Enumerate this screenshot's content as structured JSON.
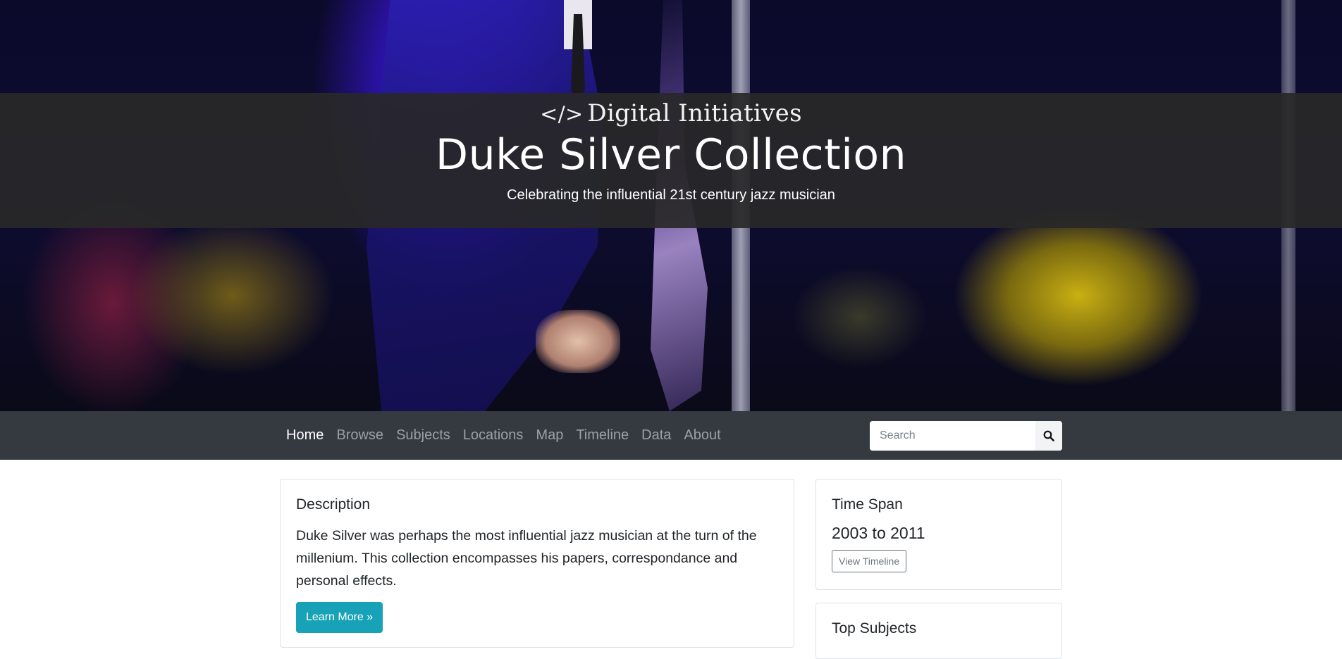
{
  "hero": {
    "brand_code": "</>",
    "brand_name": "Digital Initiatives",
    "title": "Duke Silver Collection",
    "tagline": "Celebrating the influential 21st century jazz musician"
  },
  "nav": {
    "items": [
      {
        "label": "Home",
        "active": true
      },
      {
        "label": "Browse",
        "active": false
      },
      {
        "label": "Subjects",
        "active": false
      },
      {
        "label": "Locations",
        "active": false
      },
      {
        "label": "Map",
        "active": false
      },
      {
        "label": "Timeline",
        "active": false
      },
      {
        "label": "Data",
        "active": false
      },
      {
        "label": "About",
        "active": false
      }
    ],
    "search_placeholder": "Search",
    "search_icon": "search-icon"
  },
  "description": {
    "heading": "Description",
    "text": "Duke Silver was perhaps the most influential jazz musician at the turn of the millenium. This collection encompasses his papers, correspondance and personal effects.",
    "button": "Learn More »"
  },
  "timespan": {
    "heading": "Time Span",
    "value": "2003 to 2011",
    "button": "View Timeline"
  },
  "subjects": {
    "heading": "Top Subjects"
  },
  "colors": {
    "navbar": "#343a40",
    "info_button": "#17a2b8",
    "band": "#282828"
  }
}
